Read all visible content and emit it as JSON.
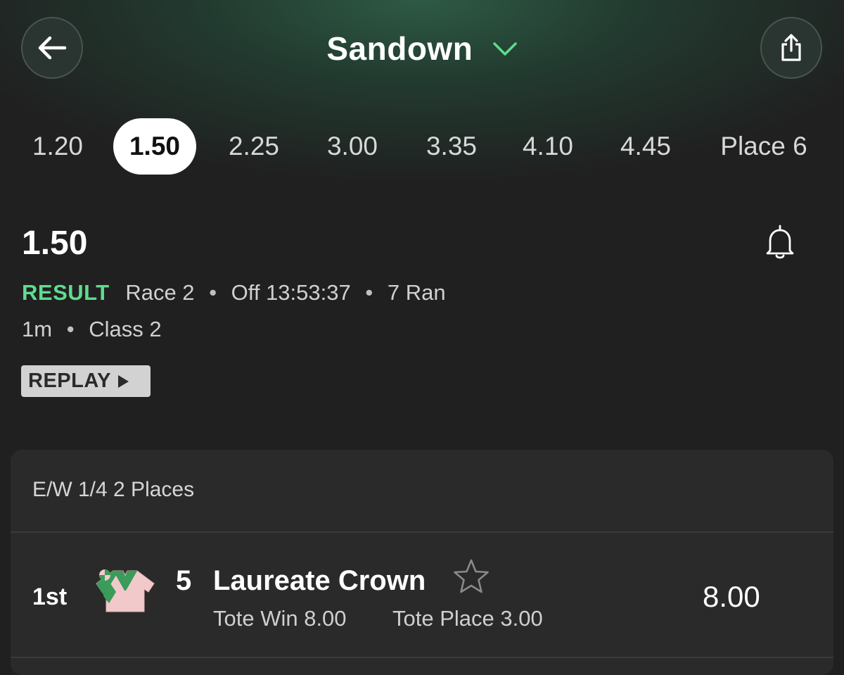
{
  "header": {
    "title": "Sandown",
    "back_icon": "arrow-left-icon",
    "share_icon": "share-icon",
    "dropdown_icon": "chevron-down-icon"
  },
  "tabs": [
    {
      "label": "1.20",
      "active": false
    },
    {
      "label": "1.50",
      "active": true
    },
    {
      "label": "2.25",
      "active": false
    },
    {
      "label": "3.00",
      "active": false
    },
    {
      "label": "3.35",
      "active": false
    },
    {
      "label": "4.10",
      "active": false
    },
    {
      "label": "4.45",
      "active": false
    },
    {
      "label": "Place 6",
      "active": false
    }
  ],
  "race": {
    "title": "1.50",
    "status": "RESULT",
    "race_number": "Race 2",
    "off_time": "Off 13:53:37",
    "runners": "7 Ran",
    "distance": "1m",
    "class": "Class 2",
    "replay_label": "REPLAY",
    "bell_icon": "bell-icon"
  },
  "card": {
    "each_way": "E/W 1/4 2 Places",
    "result": {
      "position": "1st",
      "number": "5",
      "horse": "Laureate Crown",
      "tote_win": "Tote Win 8.00",
      "tote_place": "Tote Place 3.00",
      "odds": "8.00"
    }
  },
  "colors": {
    "background": "#202020",
    "accent_green": "#5fdc8f",
    "silk_pink": "#f2c9cb",
    "silk_green": "#3a9b5a"
  }
}
